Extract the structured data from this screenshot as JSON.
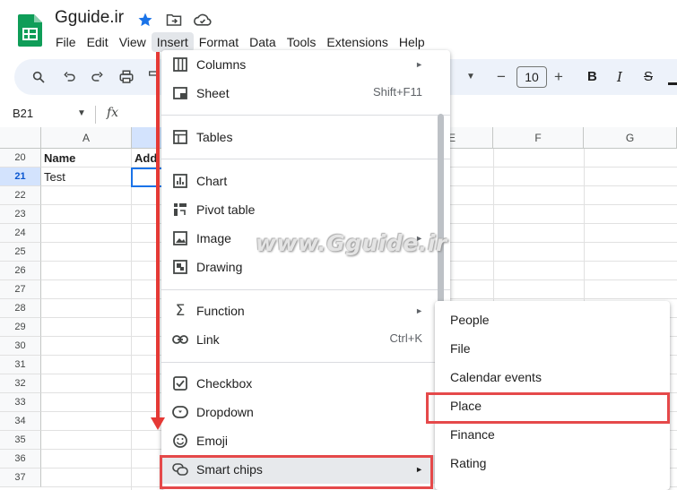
{
  "app": {
    "title": "Gguide.ir",
    "logo_color": "#0f9d58",
    "star_color": "#1a73e8"
  },
  "menubar": {
    "items": [
      "File",
      "Edit",
      "View",
      "Insert",
      "Format",
      "Data",
      "Tools",
      "Extensions",
      "Help"
    ],
    "active": "Insert"
  },
  "toolbar": {
    "font_size": "10",
    "minus": "−",
    "plus": "+",
    "bold": "B",
    "italic": "I",
    "strike": "S"
  },
  "formula_bar": {
    "cell_ref": "B21",
    "fx": "fx"
  },
  "sheet": {
    "columns": [
      "A",
      "Add",
      "E",
      "F",
      "G"
    ],
    "rows": [
      "20",
      "21",
      "22",
      "23",
      "24",
      "25",
      "26",
      "27",
      "28",
      "29",
      "30",
      "31",
      "32",
      "33",
      "34",
      "35",
      "36",
      "37"
    ],
    "selected_row": "21",
    "cells": {
      "a20": "Name",
      "b20": "Add",
      "a21": "Test"
    }
  },
  "insert_menu": {
    "items": [
      {
        "label": "Columns",
        "icon": "columns-icon",
        "submenu": true
      },
      {
        "label": "Sheet",
        "icon": "sheet-icon",
        "shortcut": "Shift+F11"
      },
      {
        "label": "Tables",
        "icon": "tables-icon"
      },
      {
        "label": "Chart",
        "icon": "chart-icon"
      },
      {
        "label": "Pivot table",
        "icon": "pivot-table-icon"
      },
      {
        "label": "Image",
        "icon": "image-icon",
        "submenu": true
      },
      {
        "label": "Drawing",
        "icon": "drawing-icon"
      },
      {
        "label": "Function",
        "icon": "sigma-icon",
        "submenu": true
      },
      {
        "label": "Link",
        "icon": "link-icon",
        "shortcut": "Ctrl+K"
      },
      {
        "label": "Checkbox",
        "icon": "checkbox-icon"
      },
      {
        "label": "Dropdown",
        "icon": "dropdown-icon"
      },
      {
        "label": "Emoji",
        "icon": "emoji-icon"
      },
      {
        "label": "Smart chips",
        "icon": "smart-chips-icon",
        "submenu": true
      }
    ],
    "submenu_arrow": "►"
  },
  "smart_chips_submenu": {
    "items": [
      "People",
      "File",
      "Calendar events",
      "Place",
      "Finance",
      "Rating"
    ],
    "highlighted": "Place"
  },
  "annotations": {
    "watermark": "www.Gguide.ir",
    "highlight_color": "#e5494a"
  }
}
